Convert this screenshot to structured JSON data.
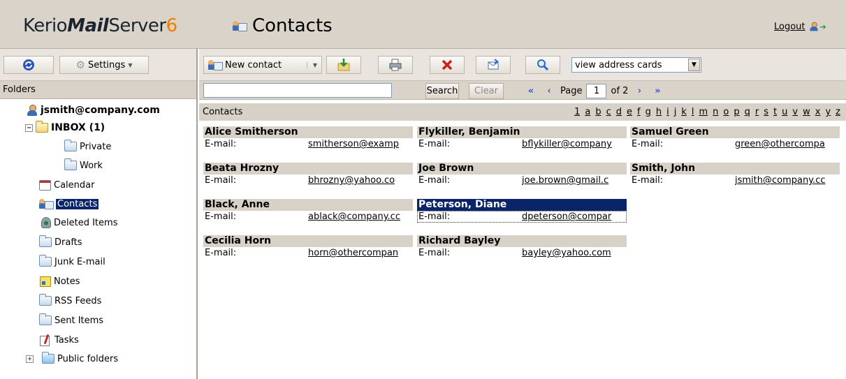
{
  "header": {
    "logo_kerio": "Kerio",
    "logo_mail": "Mail",
    "logo_server": "Server",
    "logo_version": "6",
    "page_title": "Contacts",
    "logout_label": "Logout",
    "logo_color": "#1c2430",
    "version_color": "#f07c00"
  },
  "left_toolbar": {
    "refresh_icon": "refresh-icon",
    "settings_label": "Settings"
  },
  "folders": {
    "header": "Folders",
    "account": "jsmith@company.com",
    "inbox": "INBOX (1)",
    "items": [
      {
        "label": "Private",
        "icon": "folder-icon"
      },
      {
        "label": "Work",
        "icon": "folder-icon"
      },
      {
        "label": "Calendar",
        "icon": "calendar-icon"
      },
      {
        "label": "Contacts",
        "icon": "contacts-icon",
        "selected": true
      },
      {
        "label": "Deleted Items",
        "icon": "trash-icon"
      },
      {
        "label": "Drafts",
        "icon": "folder-icon"
      },
      {
        "label": "Junk E-mail",
        "icon": "folder-icon"
      },
      {
        "label": "Notes",
        "icon": "notes-icon"
      },
      {
        "label": "RSS Feeds",
        "icon": "folder-icon"
      },
      {
        "label": "Sent Items",
        "icon": "folder-icon"
      },
      {
        "label": "Tasks",
        "icon": "tasks-icon"
      },
      {
        "label": "Public folders",
        "icon": "folder-icon"
      }
    ]
  },
  "toolbar": {
    "new_contact_label": "New contact",
    "view_select_value": "view address cards"
  },
  "search": {
    "query": "",
    "search_label": "Search",
    "clear_label": "Clear",
    "page_label": "Page",
    "page_value": "1",
    "page_total_label": "of 2"
  },
  "contacts": {
    "title": "Contacts",
    "alphabet": [
      "1",
      "a",
      "b",
      "c",
      "d",
      "e",
      "f",
      "g",
      "h",
      "i",
      "j",
      "k",
      "l",
      "m",
      "n",
      "o",
      "p",
      "q",
      "r",
      "s",
      "t",
      "u",
      "v",
      "w",
      "x",
      "y",
      "z"
    ],
    "email_label": "E-mail:",
    "columns": [
      [
        {
          "name": "Alice Smitherson",
          "email": "smitherson@examp"
        },
        {
          "name": "Beata Hrozny",
          "email": "bhrozny@yahoo.co"
        },
        {
          "name": "Black, Anne",
          "email": "ablack@company.cc"
        },
        {
          "name": "Cecilia Horn",
          "email": "horn@othercompan"
        }
      ],
      [
        {
          "name": "Flykiller, Benjamin",
          "email": "bflykiller@company"
        },
        {
          "name": "Joe Brown",
          "email": "joe.brown@gmail.c"
        },
        {
          "name": "Peterson, Diane",
          "email": "dpeterson@compar",
          "selected": true
        },
        {
          "name": "Richard Bayley",
          "email": "bayley@yahoo.com"
        }
      ],
      [
        {
          "name": "Samuel Green",
          "email": "green@othercompa"
        },
        {
          "name": "Smith, John",
          "email": "jsmith@company.cc"
        }
      ]
    ]
  },
  "colors": {
    "header_bg": "#d9d3c9",
    "selection": "#0a246a",
    "card_header": "#d7d1c7"
  }
}
